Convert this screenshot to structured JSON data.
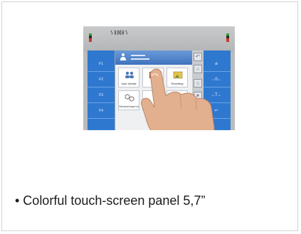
{
  "caption": "• Colorful touch-screen panel 5,7”",
  "photo": {
    "logo": "ᛊᚱᛞᚺᛊ",
    "function_keys": [
      "F1",
      "F2",
      "F3",
      "F4"
    ],
    "right_keys": [
      "⌀",
      "→0←",
      "→T←",
      "↵"
    ],
    "menu_tiles": [
      "User details",
      "",
      "Resetting",
      "Service/Input to",
      "",
      ""
    ],
    "colors": {
      "screen_blue": "#2f78cf",
      "menu_header": "#3f73bd",
      "device_body": "#b9bbbc"
    },
    "icons": [
      "user-icon",
      "back-arrow-icon",
      "home-icon",
      "menu-up-icon",
      "menu-down-icon",
      "hand-image"
    ]
  }
}
